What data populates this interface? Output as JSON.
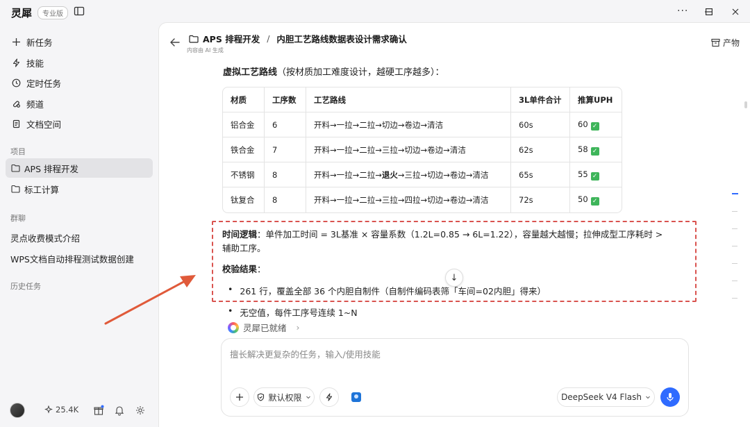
{
  "brand": {
    "name": "灵犀",
    "edition": "专业版"
  },
  "window": {
    "more": "···",
    "minimize": "—",
    "maximize": "☐",
    "close": "✕"
  },
  "nav": [
    {
      "label": "新任务",
      "icon": "plus-icon"
    },
    {
      "label": "技能",
      "icon": "bolt-icon"
    },
    {
      "label": "定时任务",
      "icon": "clock-icon"
    },
    {
      "label": "频道",
      "icon": "channel-icon"
    },
    {
      "label": "文档空间",
      "icon": "document-icon"
    }
  ],
  "sections": {
    "projects": "项目",
    "group_chat": "群聊",
    "history": "历史任务"
  },
  "projects": [
    {
      "label": "APS 排程开发",
      "active": true
    },
    {
      "label": "标工计算",
      "active": false
    }
  ],
  "group_chats": [
    {
      "label": "灵点收费模式介绍"
    },
    {
      "label": "WPS文档自动排程测试数据创建"
    }
  ],
  "sidebar_bottom": {
    "credits": "25.4K"
  },
  "header": {
    "project": "APS 排程开发",
    "separator": "/",
    "title": "内胆工艺路线数据表设计需求确认",
    "subtitle": "内容由 AI 生成",
    "artifact_label": "产物"
  },
  "content": {
    "heading_bold": "虚拟工艺路线",
    "heading_rest": "（按材质加工难度设计，越硬工序越多）：",
    "table": {
      "columns": [
        "材质",
        "工序数",
        "工艺路线",
        "3L单件合计",
        "推算UPH"
      ],
      "rows": [
        {
          "material": "铝合金",
          "steps": "6",
          "route_pre": "开料→一拉→二拉→切边→卷边→清洁",
          "route_bold": "",
          "route_post": "",
          "total": "60s",
          "uph": "60"
        },
        {
          "material": "铁合金",
          "steps": "7",
          "route_pre": "开料→一拉→二拉→三拉→切边→卷边→清洁",
          "route_bold": "",
          "route_post": "",
          "total": "62s",
          "uph": "58"
        },
        {
          "material": "不锈钢",
          "steps": "8",
          "route_pre": "开料→一拉→二拉→",
          "route_bold": "退火",
          "route_post": "→三拉→切边→卷边→清洁",
          "total": "65s",
          "uph": "55"
        },
        {
          "material": "钛复合",
          "steps": "8",
          "route_pre": "开料→一拉→二拉→三拉→四拉→切边→卷边→清洁",
          "route_bold": "",
          "route_post": "",
          "total": "72s",
          "uph": "50"
        }
      ]
    },
    "time_logic_label": "时间逻辑",
    "time_logic_line1": "：单件加工时间 = 3L基准 × 容量系数（1.2L=0.85 → 6L=1.22），容量越大越慢；拉伸成型工序耗时 >",
    "time_logic_line2": "辅助工序。",
    "verify_label": "校验结果",
    "verify_colon": "：",
    "bullets": [
      "261 行，覆盖全部 36 个内胆自制件（自制件编码表筛「车间=02内胆」得来）",
      "无空值，每件工序号连续 1~N"
    ],
    "scroll_down": "↓",
    "ready_text": "灵犀已就绪",
    "ready_chevron": "›"
  },
  "composer": {
    "placeholder": "擅长解决更复杂的任务，输入/使用技能",
    "permission_label": "默认权限",
    "model_label": "DeepSeek V4 Flash"
  },
  "colors": {
    "accent": "#2f6bff",
    "highlight": "#d9534f",
    "check": "#3eb55a"
  }
}
